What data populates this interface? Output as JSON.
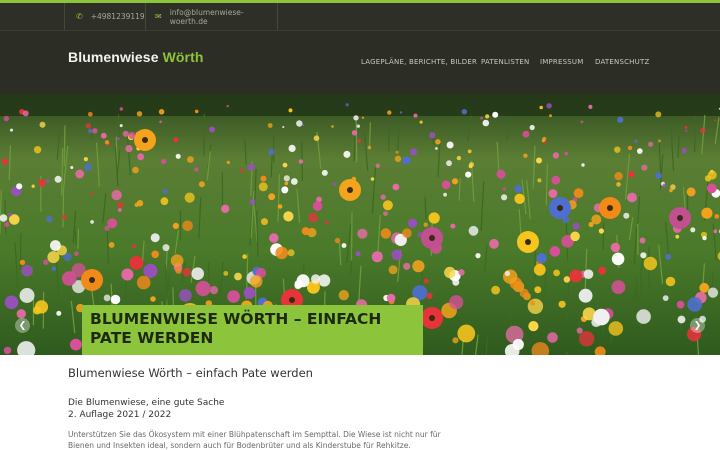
{
  "topbar": {
    "phone": "+4981239119",
    "phone_icon": "phone-icon",
    "email": "info@blumenwiese-woerth.de",
    "email_icon": "envelope-icon"
  },
  "brand": {
    "name": "Blumenwiese",
    "accent": "Wörth"
  },
  "nav": {
    "items": [
      {
        "label": "LAGEPLÄNE, BERICHTE, BILDER"
      },
      {
        "label": "PATENLISTEN"
      },
      {
        "label": "IMPRESSUM"
      },
      {
        "label": "DATENSCHUTZ"
      }
    ]
  },
  "hero": {
    "caption_line1": "BLUMENWIESE WÖRTH – EINFACH",
    "caption_line2": "PATE WERDEN",
    "prev_icon": "chevron-left-icon",
    "next_icon": "chevron-right-icon"
  },
  "content": {
    "title": "Blumenwiese Wörth – einfach Pate werden",
    "subtitle": "Die Blumenwiese, eine gute Sache",
    "edition": "2. Auflage 2021 / 2022",
    "intro": "Unterstützen Sie das Ökosystem mit einer Blühpatenschaft im Sempttal. Die Wiese ist nicht nur für Bienen und Insekten ideal, sondern auch für Bodenbrüter und als Kinderstube für Rehkitze."
  },
  "colors": {
    "accent": "#8cc43c",
    "header_bg": "#2c2e26",
    "topbar_bg": "#2e3027",
    "text": "#333333"
  }
}
